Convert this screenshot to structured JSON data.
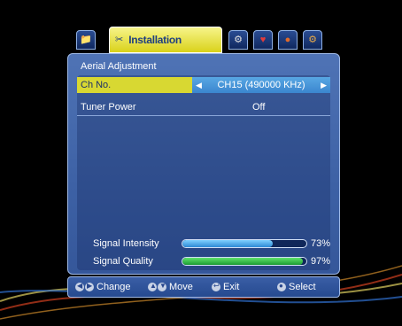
{
  "tabs": [
    {
      "icon": "📁",
      "icon_name": "folder-icon"
    },
    {
      "label": "Installation",
      "icon": "✂",
      "icon_name": "satellite-dish-icon"
    },
    {
      "icon": "⚙",
      "icon_name": "tools-icon"
    },
    {
      "icon": "♥",
      "icon_name": "favorites-icon"
    },
    {
      "icon": "●",
      "icon_name": "media-icon"
    },
    {
      "icon": "⚙",
      "icon_name": "settings-icon"
    }
  ],
  "panel": {
    "title": "Aerial Adjustment"
  },
  "rows": {
    "ch_no": {
      "label": "Ch No.",
      "value": "CH15 (490000 KHz)"
    },
    "tuner_power": {
      "label": "Tuner Power",
      "value": "Off"
    }
  },
  "signal": {
    "intensity": {
      "label": "Signal Intensity",
      "percent_text": "73%",
      "value": 0.73
    },
    "quality": {
      "label": "Signal Quality",
      "percent_text": "97%",
      "value": 0.97
    }
  },
  "help": {
    "change": "Change",
    "move": "Move",
    "exit": "Exit",
    "select": "Select"
  },
  "colors": {
    "panel_blue": "#4f73b5",
    "highlight_yellow": "#d8d832",
    "selected_value_blue": "#3b86cf",
    "intensity_bar": "#2d8ad5",
    "quality_bar": "#1d9a34"
  }
}
